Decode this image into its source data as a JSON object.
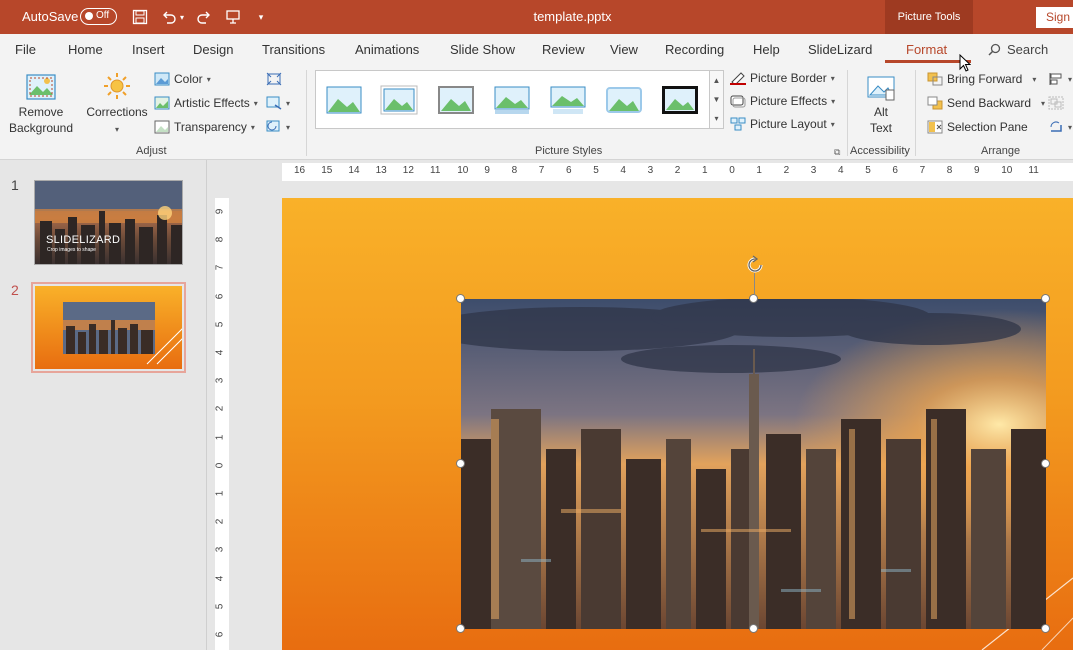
{
  "titlebar": {
    "autosave_label": "AutoSave",
    "autosave_state": "Off",
    "doc_title": "template.pptx",
    "contextual_group": "Picture Tools",
    "sign_in": "Sign"
  },
  "tabs": [
    "File",
    "Home",
    "Insert",
    "Design",
    "Transitions",
    "Animations",
    "Slide Show",
    "Review",
    "View",
    "Recording",
    "Help",
    "SlideLizard",
    "Format"
  ],
  "active_tab": "Format",
  "search_label": "Search",
  "ribbon": {
    "adjust": {
      "remove_background_line1": "Remove",
      "remove_background_line2": "Background",
      "corrections": "Corrections",
      "color": "Color",
      "artistic_effects": "Artistic Effects",
      "transparency": "Transparency",
      "group_label": "Adjust"
    },
    "picture_styles": {
      "picture_border": "Picture Border",
      "picture_effects": "Picture Effects",
      "picture_layout": "Picture Layout",
      "group_label": "Picture Styles"
    },
    "accessibility": {
      "alt_text_line1": "Alt",
      "alt_text_line2": "Text",
      "group_label": "Accessibility"
    },
    "arrange": {
      "bring_forward": "Bring Forward",
      "send_backward": "Send Backward",
      "selection_pane": "Selection Pane",
      "group_label": "Arrange"
    }
  },
  "slides": [
    {
      "number": "1",
      "title": "SLIDELIZARD",
      "subtitle": "Crop images to shape"
    },
    {
      "number": "2"
    }
  ],
  "hruler_labels": [
    "16",
    "15",
    "14",
    "13",
    "12",
    "11",
    "10",
    "9",
    "8",
    "7",
    "6",
    "5",
    "4",
    "3",
    "2",
    "1",
    "0",
    "1",
    "2",
    "3",
    "4",
    "5",
    "6",
    "7",
    "8",
    "9",
    "10",
    "11"
  ],
  "vruler_labels": [
    "9",
    "8",
    "7",
    "6",
    "5",
    "4",
    "3",
    "2",
    "1",
    "0",
    "1",
    "2",
    "3",
    "4",
    "5",
    "6"
  ],
  "colors": {
    "accent": "#b7472a",
    "slide_top": "#f9b129",
    "slide_bottom": "#e86d10"
  }
}
